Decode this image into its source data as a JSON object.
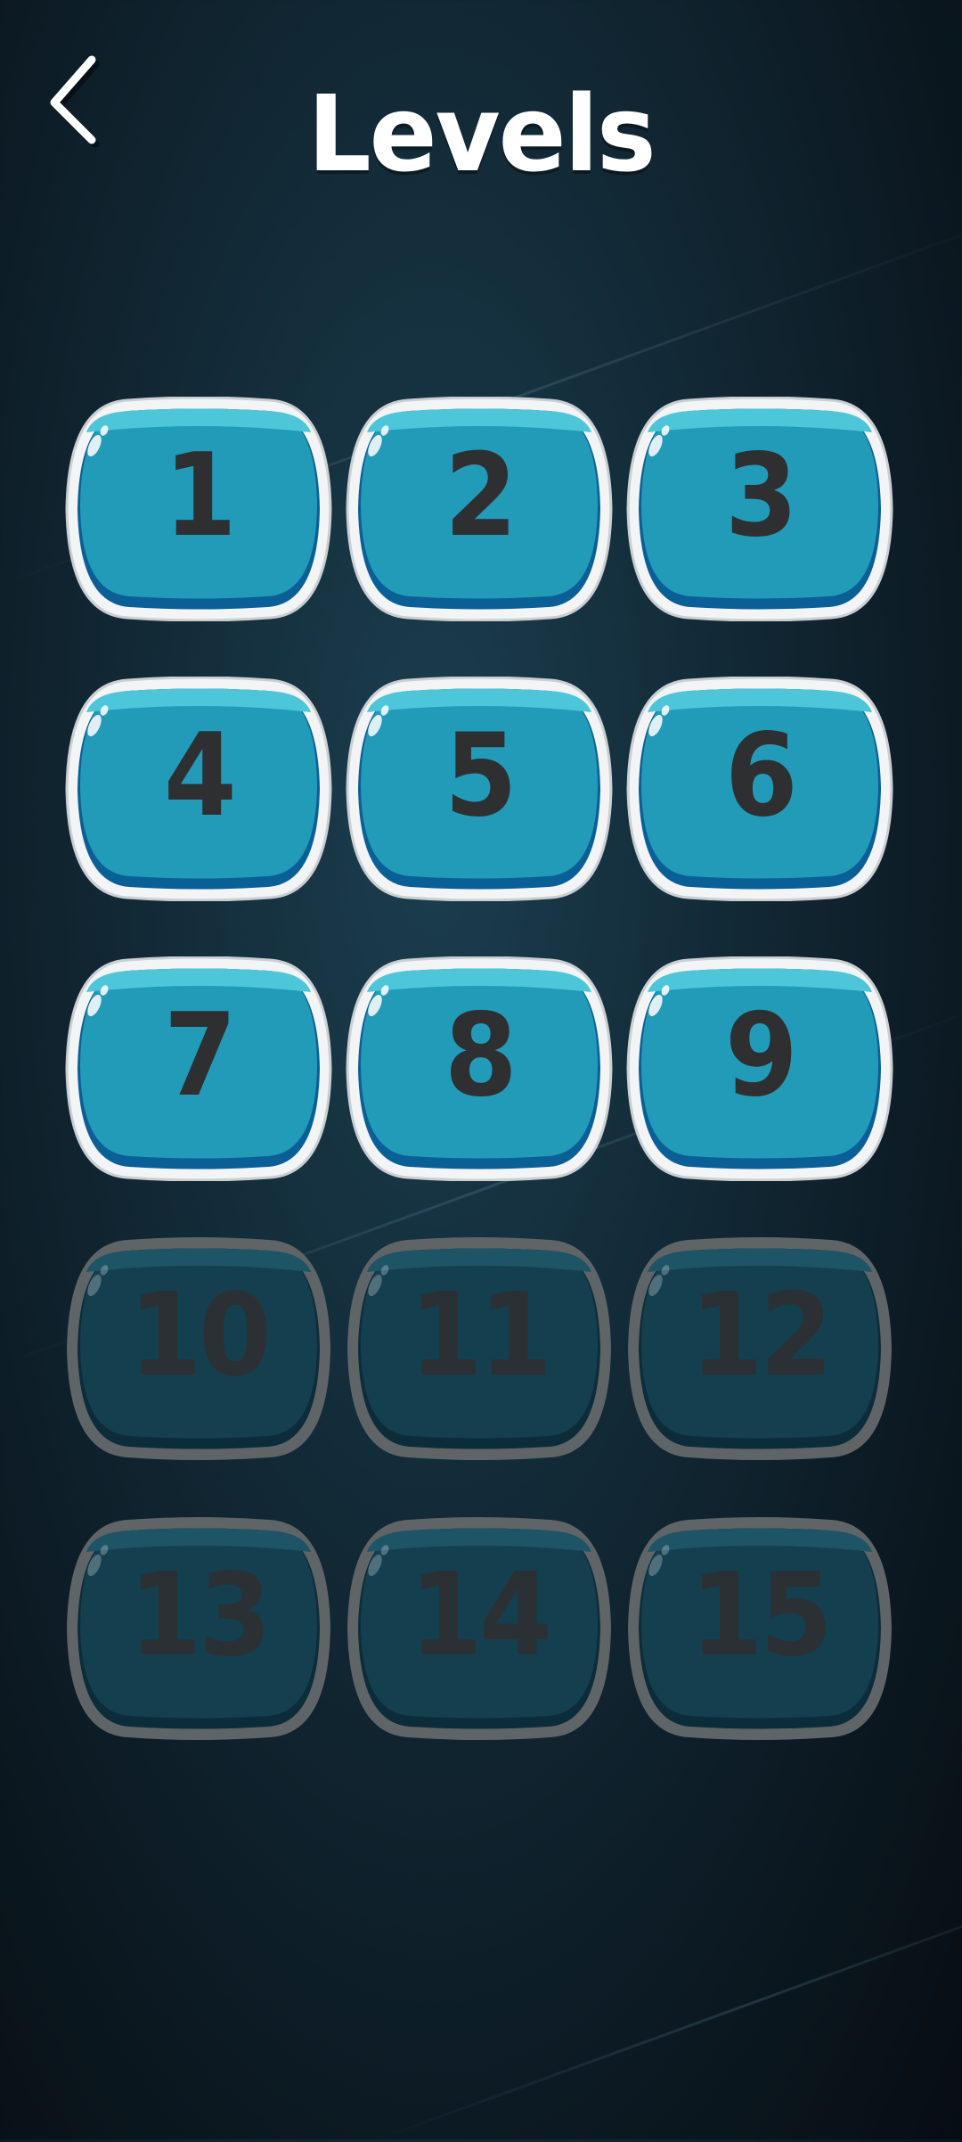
{
  "header": {
    "title": "Levels",
    "back_icon": "chevron-left-icon"
  },
  "colors": {
    "unlocked_fill": "#229bb9",
    "unlocked_border": "#f2f4f5",
    "locked_fill": "#143f4f",
    "locked_border": "#5f6467",
    "number_color": "#2e2f31"
  },
  "levels": [
    {
      "number": "1",
      "locked": false
    },
    {
      "number": "2",
      "locked": false
    },
    {
      "number": "3",
      "locked": false
    },
    {
      "number": "4",
      "locked": false
    },
    {
      "number": "5",
      "locked": false
    },
    {
      "number": "6",
      "locked": false
    },
    {
      "number": "7",
      "locked": false
    },
    {
      "number": "8",
      "locked": false
    },
    {
      "number": "9",
      "locked": false
    },
    {
      "number": "10",
      "locked": true
    },
    {
      "number": "11",
      "locked": true
    },
    {
      "number": "12",
      "locked": true
    },
    {
      "number": "13",
      "locked": true
    },
    {
      "number": "14",
      "locked": true
    },
    {
      "number": "15",
      "locked": true
    }
  ]
}
